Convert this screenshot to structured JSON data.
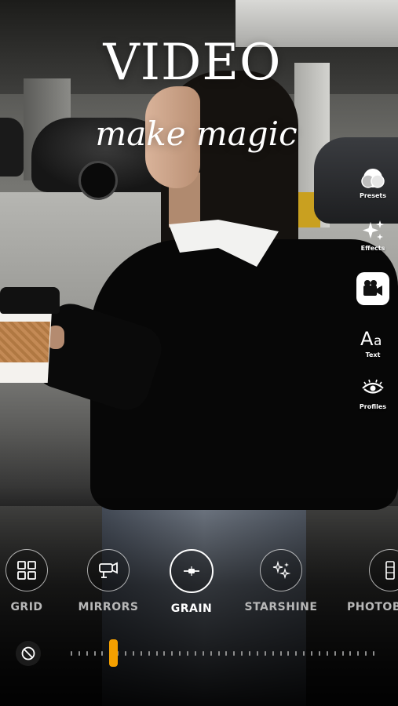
{
  "headline": {
    "title": "VIDEO",
    "subtitle": "make magic"
  },
  "tool_rail": {
    "items": [
      {
        "label": "Presets",
        "icon": "presets-icon"
      },
      {
        "label": "Effects",
        "icon": "sparkles-icon"
      },
      {
        "label": "",
        "icon": "video-camera-icon",
        "active": true
      },
      {
        "label": "Text",
        "icon": "text-aa-icon"
      },
      {
        "label": "Profiles",
        "icon": "eye-icon"
      }
    ]
  },
  "effects": {
    "items": [
      {
        "label": "GRID",
        "icon": "grid-icon"
      },
      {
        "label": "MIRRORS",
        "icon": "projector-icon"
      },
      {
        "label": "GRAIN",
        "icon": "grain-icon",
        "selected": true
      },
      {
        "label": "STARSHINE",
        "icon": "stars-icon"
      },
      {
        "label": "PHOTOB",
        "icon": "filmstrip-icon"
      }
    ]
  },
  "intensity": {
    "value_fraction": 0.14
  },
  "colors": {
    "accent": "#f5a000",
    "text": "#ffffff",
    "muted_label": "#b8b8b8"
  }
}
